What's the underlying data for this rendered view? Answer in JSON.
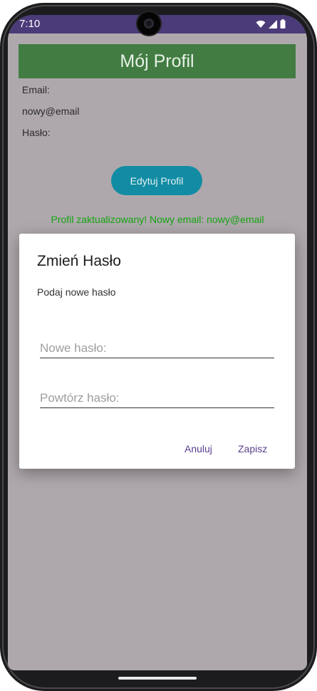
{
  "status_bar": {
    "time": "7:10",
    "icons": [
      "wifi-icon",
      "signal-icon",
      "battery-icon"
    ],
    "color": "#4b3b79"
  },
  "profile": {
    "title": "Mój Profil",
    "email_label": "Email:",
    "email_value": "nowy@email",
    "password_label": "Hasło:",
    "edit_button": "Edytuj Profil",
    "success_message": "Profil zaktualizowany! Nowy email: nowy@email"
  },
  "dialog": {
    "title": "Zmień Hasło",
    "message": "Podaj nowe hasło",
    "new_password_placeholder": "Nowe hasło:",
    "repeat_password_placeholder": "Powtórz hasło:",
    "cancel_label": "Anuluj",
    "save_label": "Zapisz"
  },
  "colors": {
    "header": "#427c43",
    "button": "#128ca4",
    "success": "#14a40f",
    "dialog_action": "#5a3f8f",
    "scrim_background": "#aea8ad"
  }
}
